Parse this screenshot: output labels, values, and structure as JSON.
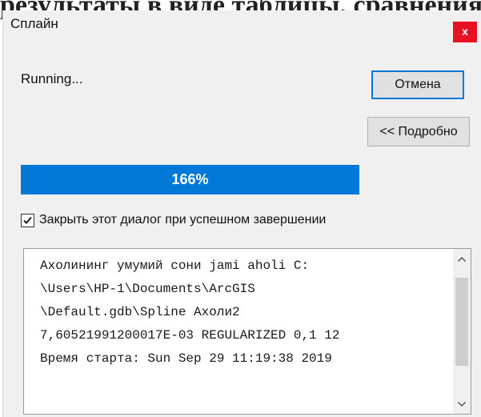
{
  "background": {
    "text": "результаты в виде таблицы, сравнения модели и реальности"
  },
  "window": {
    "title": "Сплайн",
    "close_label": "x"
  },
  "status_text": "Running...",
  "buttons": {
    "cancel_label": "Отмена",
    "details_label": "<< Подробно"
  },
  "progress": {
    "label": "166%",
    "fill_fraction": 1.0
  },
  "checkbox": {
    "label": "Закрыть этот диалог при успешном завершении",
    "checked": true
  },
  "log": {
    "lines": [
      "Ахолининг умумий сони jami aholi C:",
      "\\Users\\HP-1\\Documents\\ArcGIS",
      "\\Default.gdb\\Spline Ахоли2",
      "7,60521991200017E-03 REGULARIZED 0,1 12",
      "Время старта: Sun Sep 29 11:19:38 2019"
    ]
  },
  "colors": {
    "accent": "#0078d7",
    "close": "#e81123"
  },
  "icons": {
    "checkmark": "check-icon",
    "scroll_up": "chevron-up-icon",
    "scroll_down": "chevron-down-icon"
  }
}
